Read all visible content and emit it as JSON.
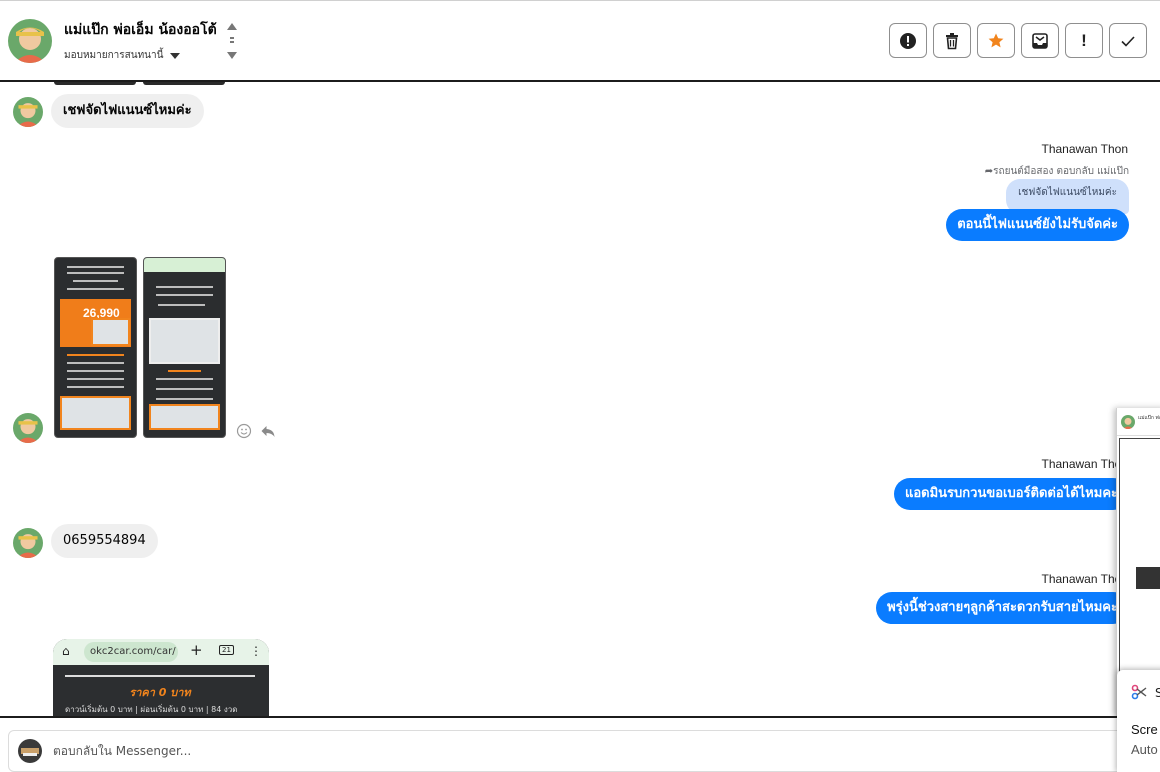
{
  "header": {
    "contact_name": "แม่แป๊ก พ่อเอ็ม น้องออโต้",
    "assign_label": "มอบหมายการสนทนานี้",
    "toolbar": {
      "alert_label": "",
      "delete_label": "",
      "star_label": "",
      "inbox_label": "",
      "priority_label": "!",
      "done_label": ""
    }
  },
  "messages": {
    "incoming_1": "เชฟจัดไฟแนนซ์ไหมค่ะ",
    "out_1": {
      "sender": "Thanawan Thon",
      "reply_note": "รถยนต์มือสอง ตอบกลับ แม่แป๊ก",
      "quoted_text": "เชฟจัดไฟแนนซ์ไหมค่ะ",
      "text": "ตอนนี้ไฟแนนซ์ยังไม่รับจัดค่ะ"
    },
    "screenshots": {
      "shot1_price": "26,990",
      "shot2_price": ""
    },
    "out_2": {
      "sender": "Thanawan Thon",
      "text": "แอดมินรบกวนขอเบอร์ติดต่อได้ไหมคะ"
    },
    "incoming_phone": "0659554894",
    "out_3": {
      "sender": "Thanawan Thon",
      "text": "พรุ่งนี้ช่วงสายๆลูกค้าสะดวกรับสายไหมคะ"
    },
    "card": {
      "url": "okc2car.com/car/",
      "tab_count": "21",
      "price_text": "ราคา 0 บาท",
      "terms_text": "ดาวน์เริ่มต้น 0 บาท | ผ่อนเริ่มต้น 0 บาท | 84 งวด"
    }
  },
  "composer": {
    "placeholder": "ตอบกลับใน Messenger..."
  },
  "side_panel": {
    "tiny_name": "แม่แป๊ก พ่อ"
  },
  "toast": {
    "s_label": "S",
    "title": "Scre",
    "subtitle": "Auto"
  },
  "colors": {
    "messenger_blue": "#0a7cff",
    "incoming_gray": "#efefef",
    "quoted_blue": "#cfe0fb",
    "star_orange": "#f1841d"
  }
}
